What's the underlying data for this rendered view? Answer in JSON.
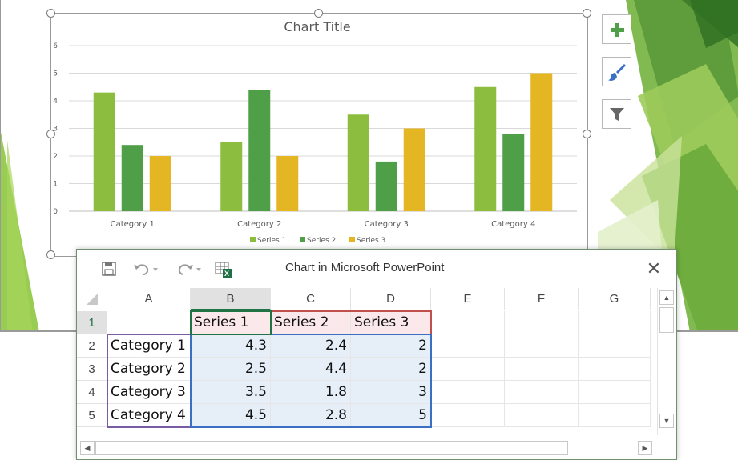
{
  "chart": {
    "colors": {
      "series1": "#8cbd3f",
      "series2": "#4e9f47",
      "series3": "#e5b623"
    }
  },
  "chart_data": {
    "type": "bar",
    "title": "Chart Title",
    "categories": [
      "Category 1",
      "Category 2",
      "Category 3",
      "Category 4"
    ],
    "series": [
      {
        "name": "Series 1",
        "values": [
          4.3,
          2.5,
          3.5,
          4.5
        ]
      },
      {
        "name": "Series 2",
        "values": [
          2.4,
          4.4,
          1.8,
          2.8
        ]
      },
      {
        "name": "Series 3",
        "values": [
          2,
          2,
          3,
          5
        ]
      }
    ],
    "ylim": [
      0,
      6
    ],
    "yticks": [
      "0",
      "1",
      "2",
      "3",
      "4",
      "5",
      "6"
    ],
    "grid": true,
    "legend_position": "bottom"
  },
  "side_buttons": [
    {
      "icon": "plus-icon"
    },
    {
      "icon": "brush-icon"
    },
    {
      "icon": "filter-icon"
    }
  ],
  "window": {
    "title": "Chart in Microsoft PowerPoint",
    "close_label": "✕",
    "icons": [
      "save-icon",
      "undo-icon",
      "redo-icon",
      "edit-data-excel-icon"
    ]
  },
  "sheet": {
    "columns": [
      "A",
      "B",
      "C",
      "D",
      "E",
      "F",
      "G"
    ],
    "rows": [
      "1",
      "2",
      "3",
      "4",
      "5"
    ],
    "header_row": [
      "",
      "Series 1",
      "Series 2",
      "Series 3"
    ],
    "data_rows": [
      [
        "Category 1",
        "4.3",
        "2.4",
        "2"
      ],
      [
        "Category 2",
        "2.5",
        "4.4",
        "2"
      ],
      [
        "Category 3",
        "3.5",
        "1.8",
        "3"
      ],
      [
        "Category 4",
        "4.5",
        "2.8",
        "5"
      ]
    ]
  }
}
